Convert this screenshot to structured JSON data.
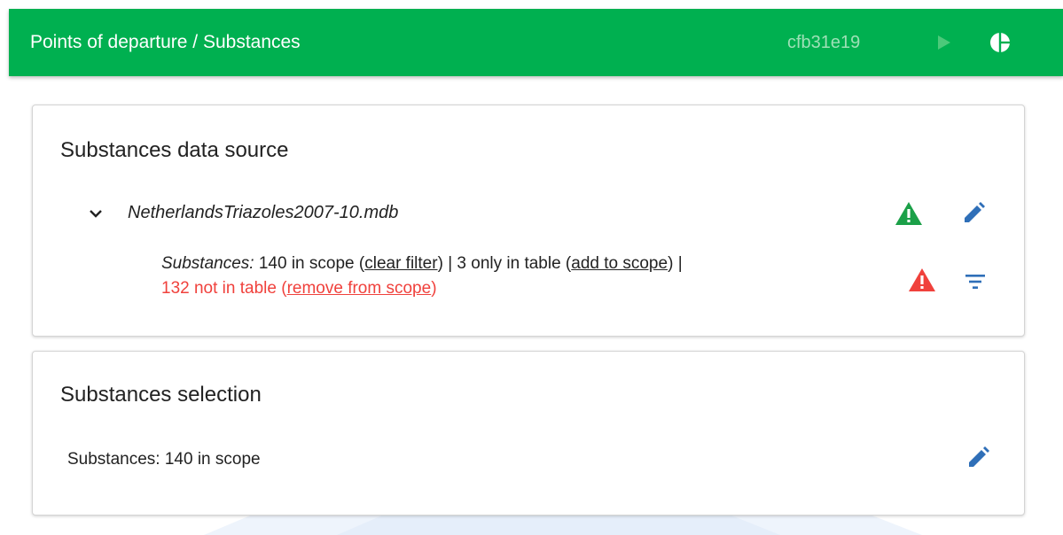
{
  "header": {
    "title": "Points of departure / Substances",
    "hash": "cfb31e19",
    "run_icon": "play-icon",
    "menu_icon": "pie-chart-icon"
  },
  "data_source_card": {
    "title": "Substances data source",
    "file_name": "NetherlandsTriazoles2007-10.mdb",
    "expand_icon": "chevron-down-icon",
    "status_icon": "warning-green-icon",
    "edit_icon": "pencil-icon",
    "info": {
      "label": "Substances:",
      "in_scope": "140 in scope",
      "clear_filter": "clear filter",
      "only_in_table": "3 only in table",
      "add_to_scope": "add to scope",
      "separator": "|",
      "not_in_table": "132 not in table",
      "remove_from_scope": "remove from scope"
    },
    "info_status_icon": "warning-red-icon",
    "filter_icon": "filter-icon"
  },
  "selection_card": {
    "title": "Substances selection",
    "text": "Substances: 140 in scope",
    "edit_icon": "pencil-icon"
  },
  "colors": {
    "header_bg": "#00b050",
    "hash_text": "#9de0b6",
    "warning_green": "#1ba048",
    "warning_red": "#f0413c",
    "edit_blue": "#2f6fb8",
    "link_red": "#f0413c"
  }
}
